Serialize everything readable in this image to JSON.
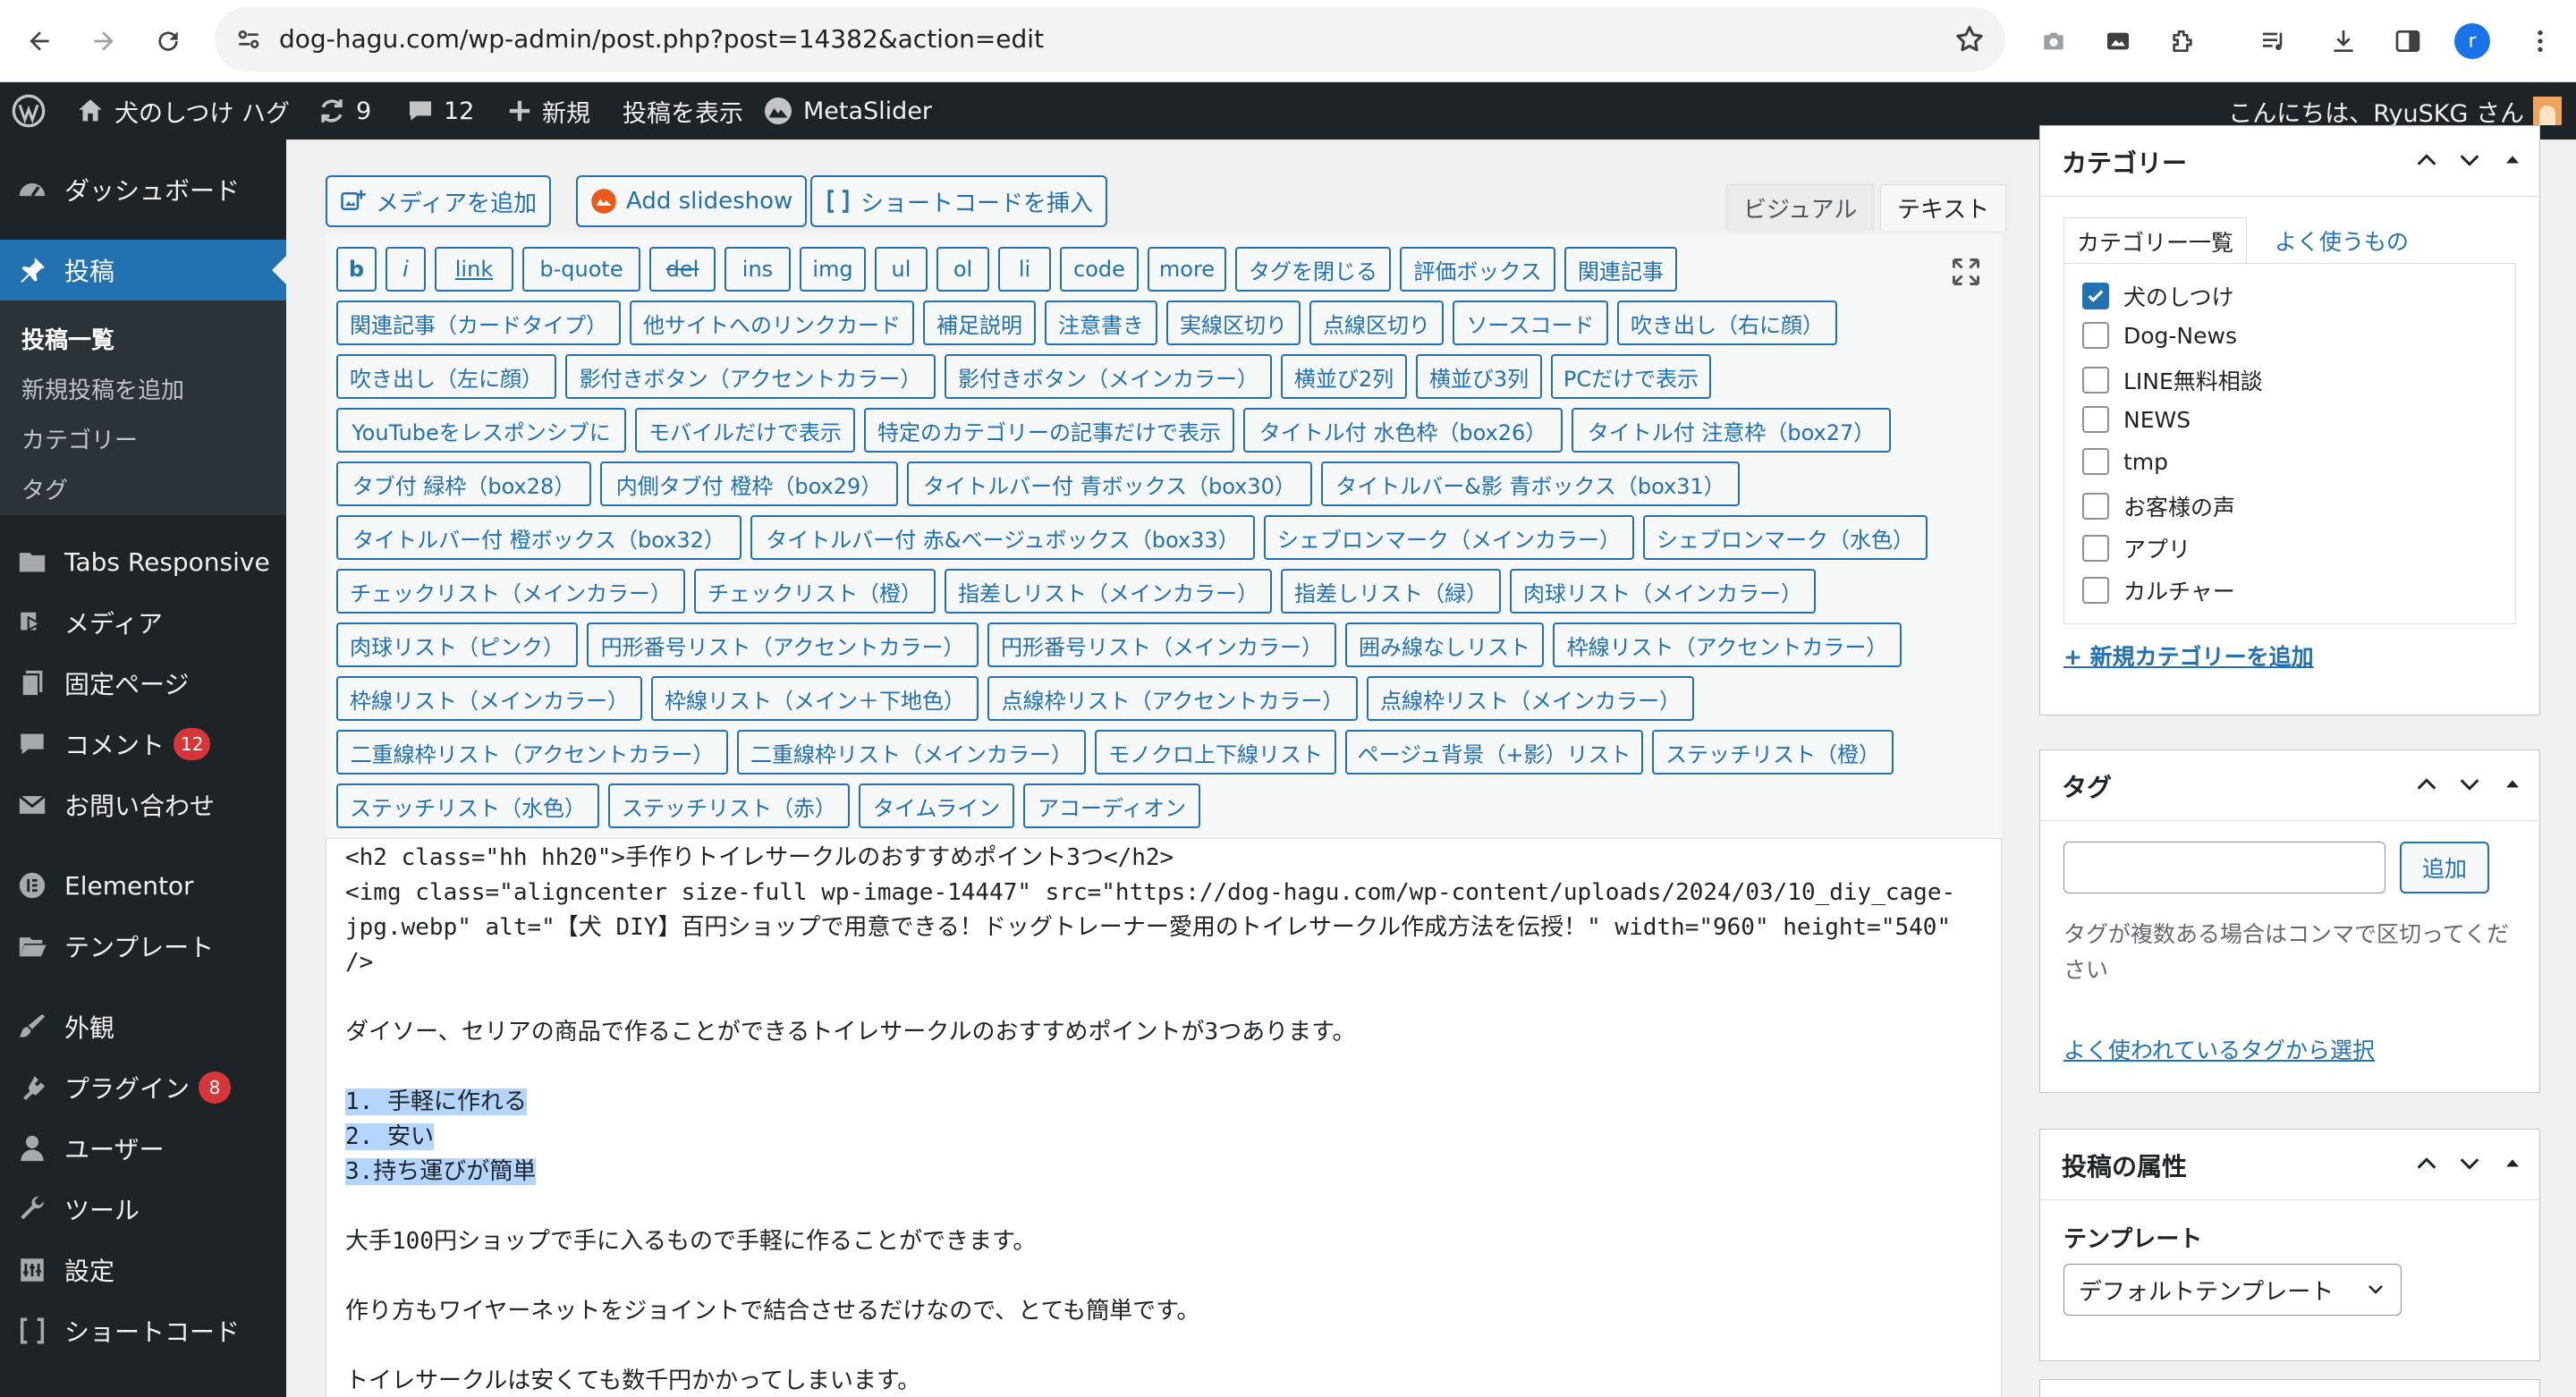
{
  "browser": {
    "url": "dog-hagu.com/wp-admin/post.php?post=14382&action=edit",
    "avatar_letter": "r",
    "accent": "#1a73e8"
  },
  "adminbar": {
    "site_name": "犬のしつけ ハグ",
    "updates_count": "9",
    "comments_count": "12",
    "new_label": "新規",
    "view_post": "投稿を表示",
    "metaslider": "MetaSlider",
    "greeting": "こんにちは、RyuSKG さん"
  },
  "sidebar": {
    "dashboard": "ダッシュボード",
    "posts": "投稿",
    "posts_sub": [
      "投稿一覧",
      "新規投稿を追加",
      "カテゴリー",
      "タグ"
    ],
    "tabs_responsive": "Tabs Responsive",
    "media": "メディア",
    "pages": "固定ページ",
    "comments": "コメント",
    "comments_badge": "12",
    "contact": "お問い合わせ",
    "elementor": "Elementor",
    "templates": "テンプレート",
    "appearance": "外観",
    "plugins": "プラグイン",
    "plugins_badge": "8",
    "users": "ユーザー",
    "tools": "ツール",
    "settings": "設定",
    "shortcode": "ショートコード",
    "active_color": "#2271b1"
  },
  "editor": {
    "add_media": "メディアを追加",
    "add_slideshow": "Add slideshow",
    "insert_shortcode": "ショートコードを挿入",
    "tab_visual": "ビジュアル",
    "tab_text": "テキスト",
    "quicktags": [
      "b",
      "i",
      "link",
      "b-quote",
      "del",
      "ins",
      "img",
      "ul",
      "ol",
      "li",
      "code",
      "more",
      "タグを閉じる",
      "評価ボックス",
      "関連記事",
      "関連記事（カードタイプ）",
      "他サイトへのリンクカード",
      "補足説明",
      "注意書き",
      "実線区切り",
      "点線区切り",
      "ソースコード",
      "吹き出し（右に顔）",
      "吹き出し（左に顔）",
      "影付きボタン（アクセントカラー）",
      "影付きボタン（メインカラー）",
      "横並び2列",
      "横並び3列",
      "PCだけで表示",
      "YouTubeをレスポンシブに",
      "モバイルだけで表示",
      "特定のカテゴリーの記事だけで表示",
      "タイトル付 水色枠（box26）",
      "タイトル付 注意枠（box27）",
      "タブ付 緑枠（box28）",
      "内側タブ付 橙枠（box29）",
      "タイトルバー付 青ボックス（box30）",
      "タイトルバー&影 青ボックス（box31）",
      "タイトルバー付 橙ボックス（box32）",
      "タイトルバー付 赤&ベージュボックス（box33）",
      "シェブロンマーク（メインカラー）",
      "シェブロンマーク（水色）",
      "チェックリスト（メインカラー）",
      "チェックリスト（橙）",
      "指差しリスト（メインカラー）",
      "指差しリスト（緑）",
      "肉球リスト（メインカラー）",
      "肉球リスト（ピンク）",
      "円形番号リスト（アクセントカラー）",
      "円形番号リスト（メインカラー）",
      "囲み線なしリスト",
      "枠線リスト（アクセントカラー）",
      "枠線リスト（メインカラー）",
      "枠線リスト（メイン＋下地色）",
      "点線枠リスト（アクセントカラー）",
      "点線枠リスト（メインカラー）",
      "二重線枠リスト（アクセントカラー）",
      "二重線枠リスト（メインカラー）",
      "モノクロ上下線リスト",
      "ページュ背景（+影）リスト",
      "ステッチリスト（橙）",
      "ステッチリスト（水色）",
      "ステッチリスト（赤）",
      "タイムライン",
      "アコーディオン"
    ],
    "content_lines": [
      "<h2 class=\"hh hh20\">手作りトイレサークルのおすすめポイント3つ</h2>",
      "<img class=\"aligncenter size-full wp-image-14447\" src=\"https://dog-hagu.com/wp-content/uploads/2024/03/10_diy_cage-jpg.webp\" alt=\"【犬 DIY】百円ショップで用意できる！ドッグトレーナー愛用のトイレサークル作成方法を伝授！\" width=\"960\" height=\"540\" />",
      "",
      "ダイソー、セリアの商品で作ることができるトイレサークルのおすすめポイントが3つあります。",
      "",
      "1. 手軽に作れる",
      "2. 安い",
      "3.持ち運びが簡単",
      "",
      "大手100円ショップで手に入るもので手軽に作ることができます。",
      "",
      "作り方もワイヤーネットをジョイントで結合させるだけなので、とても簡単です。",
      "",
      "トイレサークルは安くても数千円かかってしまいます。"
    ]
  },
  "categories_box": {
    "title": "カテゴリー",
    "tab_all": "カテゴリー一覧",
    "tab_popular": "よく使うもの",
    "items": [
      {
        "label": "犬のしつけ",
        "checked": true
      },
      {
        "label": "Dog-News",
        "checked": false
      },
      {
        "label": "LINE無料相談",
        "checked": false
      },
      {
        "label": "NEWS",
        "checked": false
      },
      {
        "label": "tmp",
        "checked": false
      },
      {
        "label": "お客様の声",
        "checked": false
      },
      {
        "label": "アプリ",
        "checked": false
      },
      {
        "label": "カルチャー",
        "checked": false
      }
    ],
    "add_new": "+ 新規カテゴリーを追加"
  },
  "tags_box": {
    "title": "タグ",
    "add_button": "追加",
    "help": "タグが複数ある場合はコンマで区切ってください",
    "choose_link": "よく使われているタグから選択"
  },
  "attributes_box": {
    "title": "投稿の属性",
    "template_label": "テンプレート",
    "template_value": "デフォルトテンプレート"
  }
}
